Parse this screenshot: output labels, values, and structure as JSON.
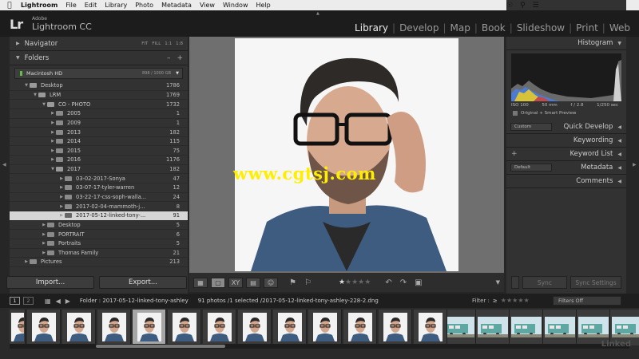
{
  "menubar": {
    "apple": "",
    "items": [
      "Lightroom",
      "File",
      "Edit",
      "Library",
      "Photo",
      "Metadata",
      "View",
      "Window",
      "Help"
    ]
  },
  "identity": {
    "logo": "Lr",
    "adobe": "Adobe",
    "app_name": "Lightroom CC"
  },
  "modules": [
    "Library",
    "Develop",
    "Map",
    "Book",
    "Slideshow",
    "Print",
    "Web"
  ],
  "active_module": "Library",
  "navigator": {
    "title": "Navigator",
    "opts": [
      "FIT",
      "FILL",
      "1:1",
      "1:8"
    ]
  },
  "folders_panel": {
    "title": "Folders",
    "volume": {
      "name": "Macintosh HD",
      "size": "898 / 1000 GB"
    },
    "rows": [
      {
        "name": "Desktop",
        "count": "1786",
        "depth": 1,
        "open": true
      },
      {
        "name": "LRM",
        "count": "1769",
        "depth": 2,
        "open": true
      },
      {
        "name": "CO - PHOTO",
        "count": "1732",
        "depth": 3,
        "open": true
      },
      {
        "name": "2005",
        "count": "1",
        "depth": 4,
        "open": false
      },
      {
        "name": "2009",
        "count": "1",
        "depth": 4,
        "open": false
      },
      {
        "name": "2013",
        "count": "182",
        "depth": 4,
        "open": false
      },
      {
        "name": "2014",
        "count": "115",
        "depth": 4,
        "open": false
      },
      {
        "name": "2015",
        "count": "75",
        "depth": 4,
        "open": false
      },
      {
        "name": "2016",
        "count": "1176",
        "depth": 4,
        "open": false
      },
      {
        "name": "2017",
        "count": "182",
        "depth": 4,
        "open": true
      },
      {
        "name": "03-02-2017-Sonya",
        "count": "47",
        "depth": 5,
        "open": false
      },
      {
        "name": "03-07-17-tyler-warren",
        "count": "12",
        "depth": 5,
        "open": false
      },
      {
        "name": "03-22-17-css-soph-walla...",
        "count": "24",
        "depth": 5,
        "open": false
      },
      {
        "name": "2017-02-04-mammoth-j...",
        "count": "8",
        "depth": 5,
        "open": false
      },
      {
        "name": "2017-05-12-linked-tony-...",
        "count": "91",
        "depth": 5,
        "open": false,
        "selected": true
      },
      {
        "name": "Desktop",
        "count": "5",
        "depth": 3,
        "open": false
      },
      {
        "name": "PORTRAIT",
        "count": "6",
        "depth": 3,
        "open": false
      },
      {
        "name": "Portraits",
        "count": "5",
        "depth": 3,
        "open": false
      },
      {
        "name": "Thomas Family",
        "count": "21",
        "depth": 3,
        "open": false
      },
      {
        "name": "Pictures",
        "count": "213",
        "depth": 1,
        "open": false
      }
    ]
  },
  "left_buttons": {
    "import": "Import...",
    "export": "Export..."
  },
  "watermark": "www.cgtsj.com",
  "toolbar": {
    "rating": 1,
    "rating_max": 5
  },
  "histogram": {
    "title": "Histogram",
    "iso": "ISO 100",
    "focal": "50 mm",
    "aperture": "f / 2.8",
    "shutter": "1/250 sec",
    "preview": "Original + Smart Preview"
  },
  "right_panels": {
    "quick_develop": {
      "title": "Quick Develop",
      "preset": "Custom"
    },
    "keywording": "Keywording",
    "keyword_list": "Keyword List",
    "metadata": {
      "title": "Metadata",
      "preset": "Default"
    },
    "comments": "Comments"
  },
  "sync": {
    "sync": "Sync",
    "sync_settings": "Sync Settings"
  },
  "filmstrip_bar": {
    "monitor1": "1",
    "monitor2": "2",
    "folder_label": "Folder : 2017-05-12-linked-tony-ashley",
    "photos": "91 photos /1 selected /2017-05-12-linked-tony-ashley-228-2.dng",
    "filter_label": "Filter :",
    "filter_op": "≥",
    "filters_off": "Filters Off"
  },
  "filmstrip": {
    "selected_index": 4,
    "watermark": "Linked"
  },
  "colors": {
    "selected_row": "#d6d6d6",
    "watermark": "#ffee00",
    "volume_led": "#5fbf4a"
  }
}
